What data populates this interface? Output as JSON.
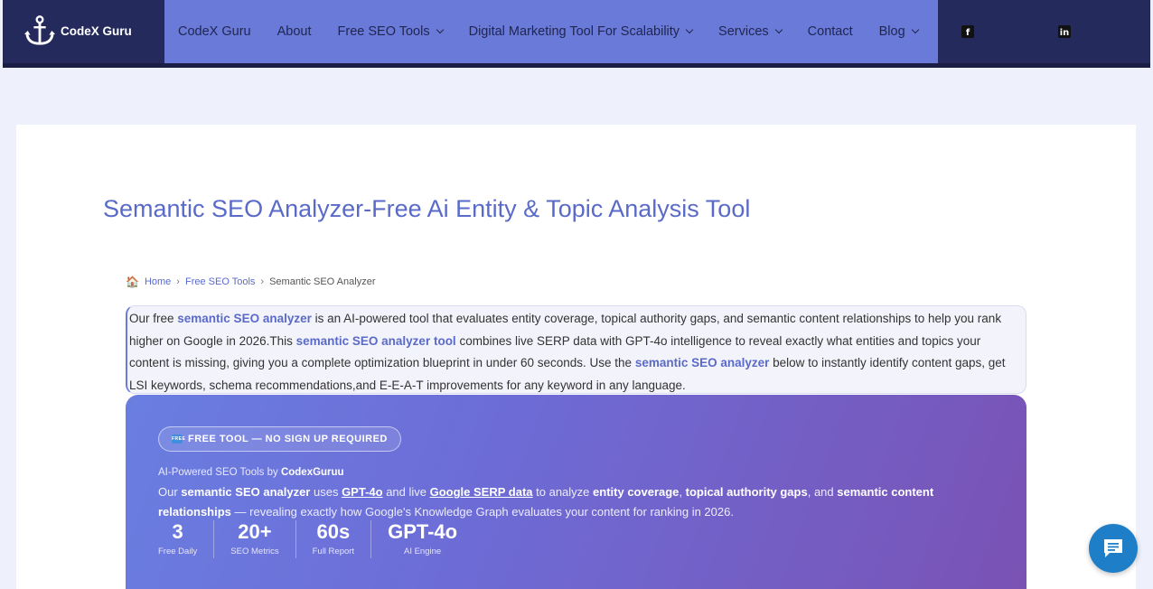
{
  "header": {
    "logo_text": "CodeX Guru",
    "nav": [
      {
        "label": "CodeX Guru",
        "dropdown": false
      },
      {
        "label": "About",
        "dropdown": false
      },
      {
        "label": "Free SEO Tools",
        "dropdown": true
      },
      {
        "label": "Digital Marketing Tool For Scalability",
        "dropdown": true
      },
      {
        "label": "Services",
        "dropdown": true
      },
      {
        "label": "Contact",
        "dropdown": false
      },
      {
        "label": "Blog",
        "dropdown": true
      }
    ],
    "social": [
      "facebook-icon",
      "linkedin-icon"
    ]
  },
  "page": {
    "title": "Semantic SEO Analyzer-Free Ai Entity & Topic Analysis Tool"
  },
  "breadcrumb": {
    "home": "Home",
    "parent": "Free SEO Tools",
    "current": "Semantic SEO Analyzer",
    "separator": "›"
  },
  "intro": {
    "p1": "Our free ",
    "link1": "semantic SEO analyzer",
    "p2": " is an AI-powered tool that evaluates entity coverage, topical authority gaps, and semantic content relationships to help you rank higher on Google in 2026.This ",
    "link2": "semantic SEO analyzer tool",
    "p3": " combines live SERP data with GPT-4o intelligence to reveal exactly what entities and topics your content is missing, giving you a complete optimization blueprint in under 60 seconds. Use the ",
    "link3": "semantic SEO analyzer",
    "p4": " below to instantly identify content gaps, get LSI keywords, schema recommendations,and E-E-A-T improvements for any keyword in any language."
  },
  "hero": {
    "badge": "FREE TOOL — NO SIGN UP REQUIRED",
    "badge_icon": "free",
    "sub_prefix": "AI-Powered SEO Tools by ",
    "sub_brand": "CodexGuruu",
    "desc": {
      "t1": "Our ",
      "b1": "semantic SEO analyzer",
      "t2": " uses ",
      "u1": "GPT-4o",
      "t3": " and live ",
      "u2": "Google SERP data",
      "t4": " to analyze ",
      "b2": "entity coverage",
      "t5": ", ",
      "b3": "topical authority gaps",
      "t6": ", and ",
      "b4": "semantic content relationships",
      "t7": " — revealing exactly how Google's Knowledge Graph evaluates your content for ranking in 2026."
    },
    "stats": [
      {
        "value": "3",
        "label": "Free Daily"
      },
      {
        "value": "20+",
        "label": "SEO Metrics"
      },
      {
        "value": "60s",
        "label": "Full Report"
      },
      {
        "value": "GPT-4o",
        "label": "AI Engine"
      }
    ]
  },
  "colors": {
    "header_bg": "#252a5c",
    "nav_bg": "#6a7ad8",
    "accent": "#5a6ac8",
    "chat_button": "#1e7fc8"
  }
}
